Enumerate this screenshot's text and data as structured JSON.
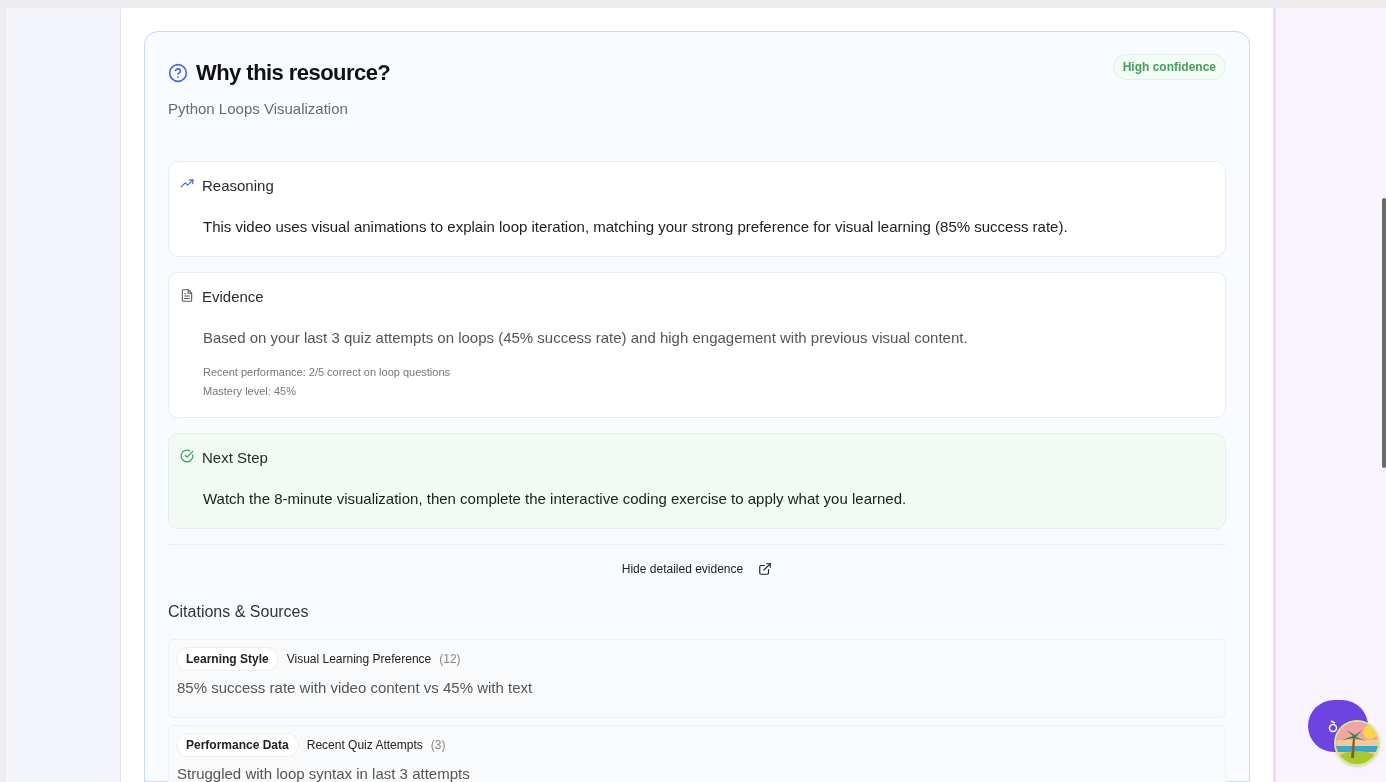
{
  "header": {
    "title": "Why this resource?",
    "subtitle": "Python Loops Visualization",
    "badge": "High confidence"
  },
  "sections": [
    {
      "kind": "reasoning",
      "title": "Reasoning",
      "text": "This video uses visual animations to explain loop iteration, matching your strong preference for visual learning (85% success rate)."
    },
    {
      "kind": "evidence",
      "title": "Evidence",
      "text": "Based on your last 3 quiz attempts on loops (45% success rate) and high engagement with previous visual content.",
      "details": [
        "Recent performance: 2/5 correct on loop questions",
        "Mastery level: 45%"
      ]
    },
    {
      "kind": "next",
      "title": "Next Step",
      "text": "Watch the 8-minute visualization, then complete the interactive coding exercise to apply what you learned."
    }
  ],
  "toggle": {
    "label": "Hide detailed evidence"
  },
  "citations": {
    "title": "Citations & Sources",
    "items": [
      {
        "tag": "Learning Style",
        "source": "Visual Learning Preference",
        "count": "(12)",
        "text": "85% success rate with video content vs 45% with text"
      },
      {
        "tag": "Performance Data",
        "source": "Recent Quiz Attempts",
        "count": "(3)",
        "text": "Struggled with loop syntax in last 3 attempts"
      }
    ]
  }
}
